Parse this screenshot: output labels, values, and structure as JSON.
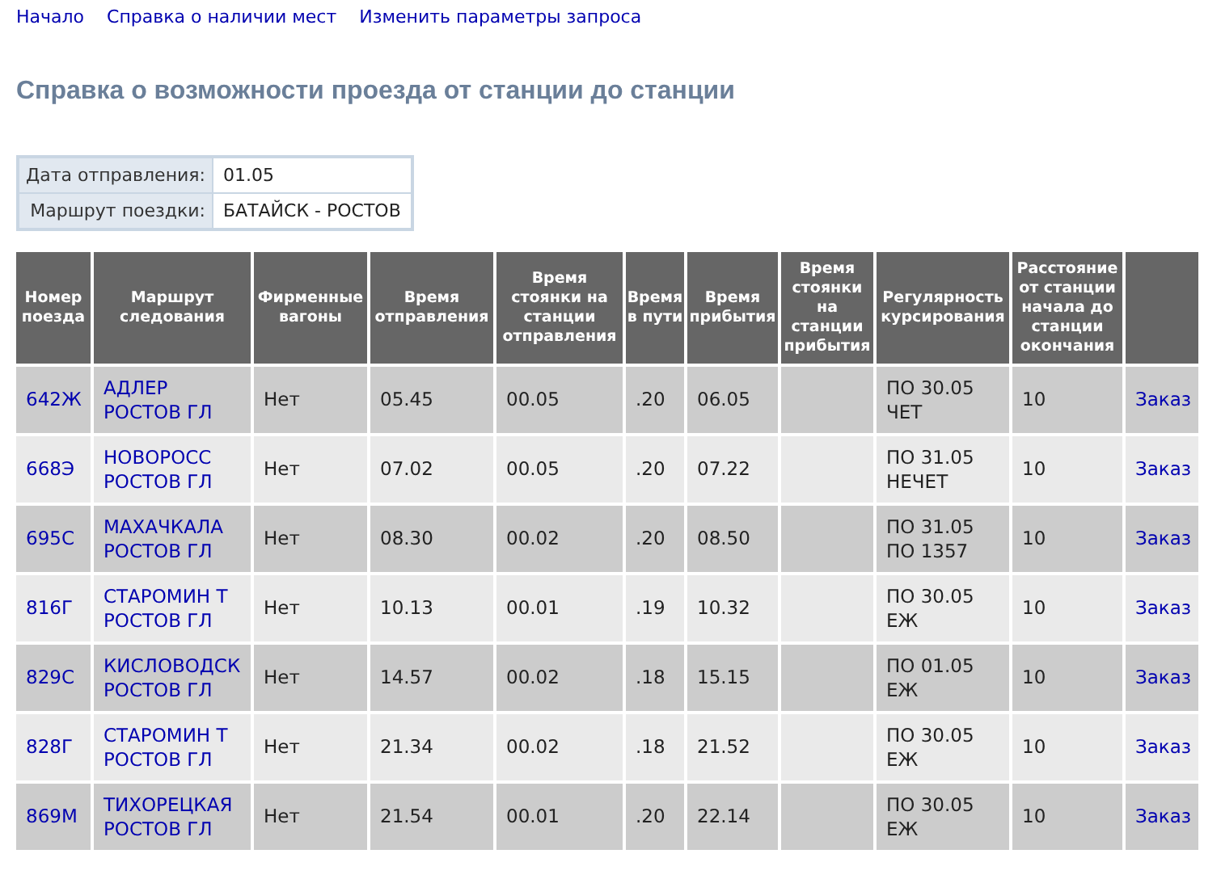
{
  "nav_links": [
    "Начало",
    "Справка о наличии мест",
    "Изменить параметры запроса"
  ],
  "heading": "Справка о возможности проезда от станции до станции",
  "query_info": [
    {
      "label": "Дата отправления:",
      "value": "01.05"
    },
    {
      "label": "Маршрут поездки:",
      "value": "БАТАЙСК - РОСТОВ"
    }
  ],
  "table": {
    "columns": [
      "Номер поезда",
      "Маршрут следования",
      "Фирменные вагоны",
      "Время отправления",
      "Время стоянки на станции отправления",
      "Время в пути",
      "Время прибытия",
      "Время стоянки на станции прибытия",
      "Регулярность курсирования",
      "Расстояние от станции начала до станции окончания"
    ],
    "rows": [
      {
        "train": "642Ж",
        "route": [
          "АДЛЕР",
          "РОСТОВ ГЛ"
        ],
        "branded": "Нет",
        "departure": "05.45",
        "dep_stop": "00.05",
        "travel": ".20",
        "arrival": "06.05",
        "arr_stop": "",
        "regularity": [
          "ПО 30.05",
          "ЧЕТ"
        ],
        "distance": "10",
        "order": "Заказ"
      },
      {
        "train": "668Э",
        "route": [
          "НОВОРОСС",
          "РОСТОВ ГЛ"
        ],
        "branded": "Нет",
        "departure": "07.02",
        "dep_stop": "00.05",
        "travel": ".20",
        "arrival": "07.22",
        "arr_stop": "",
        "regularity": [
          "ПО 31.05",
          "НЕЧЕТ"
        ],
        "distance": "10",
        "order": "Заказ"
      },
      {
        "train": "695С",
        "route": [
          "МАХАЧКАЛА",
          "РОСТОВ ГЛ"
        ],
        "branded": "Нет",
        "departure": "08.30",
        "dep_stop": "00.02",
        "travel": ".20",
        "arrival": "08.50",
        "arr_stop": "",
        "regularity": [
          "ПО 31.05",
          "ПО 1357"
        ],
        "distance": "10",
        "order": "Заказ"
      },
      {
        "train": "816Г",
        "route": [
          "СТАРОМИН Т",
          "РОСТОВ ГЛ"
        ],
        "branded": "Нет",
        "departure": "10.13",
        "dep_stop": "00.01",
        "travel": ".19",
        "arrival": "10.32",
        "arr_stop": "",
        "regularity": [
          "ПО 30.05",
          "ЕЖ"
        ],
        "distance": "10",
        "order": "Заказ"
      },
      {
        "train": "829С",
        "route": [
          "КИСЛОВОДСК",
          "РОСТОВ ГЛ"
        ],
        "branded": "Нет",
        "departure": "14.57",
        "dep_stop": "00.02",
        "travel": ".18",
        "arrival": "15.15",
        "arr_stop": "",
        "regularity": [
          "ПО 01.05",
          "ЕЖ"
        ],
        "distance": "10",
        "order": "Заказ"
      },
      {
        "train": "828Г",
        "route": [
          "СТАРОМИН Т",
          "РОСТОВ ГЛ"
        ],
        "branded": "Нет",
        "departure": "21.34",
        "dep_stop": "00.02",
        "travel": ".18",
        "arrival": "21.52",
        "arr_stop": "",
        "regularity": [
          "ПО 30.05",
          "ЕЖ"
        ],
        "distance": "10",
        "order": "Заказ"
      },
      {
        "train": "869М",
        "route": [
          "ТИХОРЕЦКАЯ",
          "РОСТОВ ГЛ"
        ],
        "branded": "Нет",
        "departure": "21.54",
        "dep_stop": "00.01",
        "travel": ".20",
        "arrival": "22.14",
        "arr_stop": "",
        "regularity": [
          "ПО 30.05",
          "ЕЖ"
        ],
        "distance": "10",
        "order": "Заказ"
      }
    ]
  }
}
